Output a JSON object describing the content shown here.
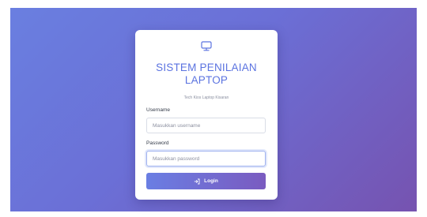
{
  "login": {
    "logo_icon": "monitor-icon",
    "title_line1": "SISTEM PENILAIAN",
    "title_line2": "LAPTOP",
    "subtitle": "Tech Kios Laptop Kisaran",
    "username_label": "Username",
    "username_placeholder": "Masukkan username",
    "username_value": "",
    "password_label": "Password",
    "password_placeholder": "Masukkan password",
    "password_value": "",
    "login_icon": "login-arrow-icon",
    "login_label": "Login"
  },
  "colors": {
    "accent": "#5b73e0",
    "gradient_start": "#6a7fe0",
    "gradient_end": "#7653b0"
  }
}
